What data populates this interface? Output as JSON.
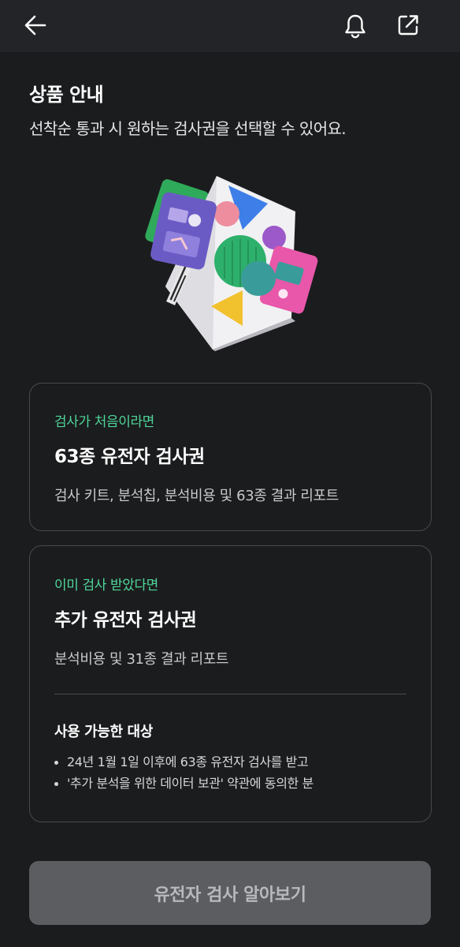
{
  "header": {
    "back_icon": "arrow-left-icon",
    "bell_icon": "bell-icon",
    "share_icon": "external-share-icon"
  },
  "intro": {
    "title": "상품 안내",
    "subtitle": "선착순 통과 시 원하는 검사권을 선택할 수 있어요."
  },
  "colors": {
    "background": "#1b1c1e",
    "topbar": "#232427",
    "accent_green": "#4fd79a",
    "card_border": "#48494d",
    "cta_background": "#5b5d61",
    "cta_text": "#b8b9bd"
  },
  "cards": [
    {
      "eyebrow": "검사가 처음이라면",
      "title": "63종 유전자 검사권",
      "description": "검사 키트, 분석칩, 분석비용 및 63종 결과 리포트"
    },
    {
      "eyebrow": "이미 검사 받았다면",
      "title": "추가 유전자 검사권",
      "description": "분석비용 및 31종 결과 리포트",
      "eligible_heading": "사용 가능한 대상",
      "eligible_items": [
        "24년 1월 1일 이후에 63종 유전자 검사를 받고",
        "'추가 분석을 위한 데이터 보관' 약관에 동의한 분"
      ]
    }
  ],
  "cta": {
    "label": "유전자 검사 알아보기"
  }
}
